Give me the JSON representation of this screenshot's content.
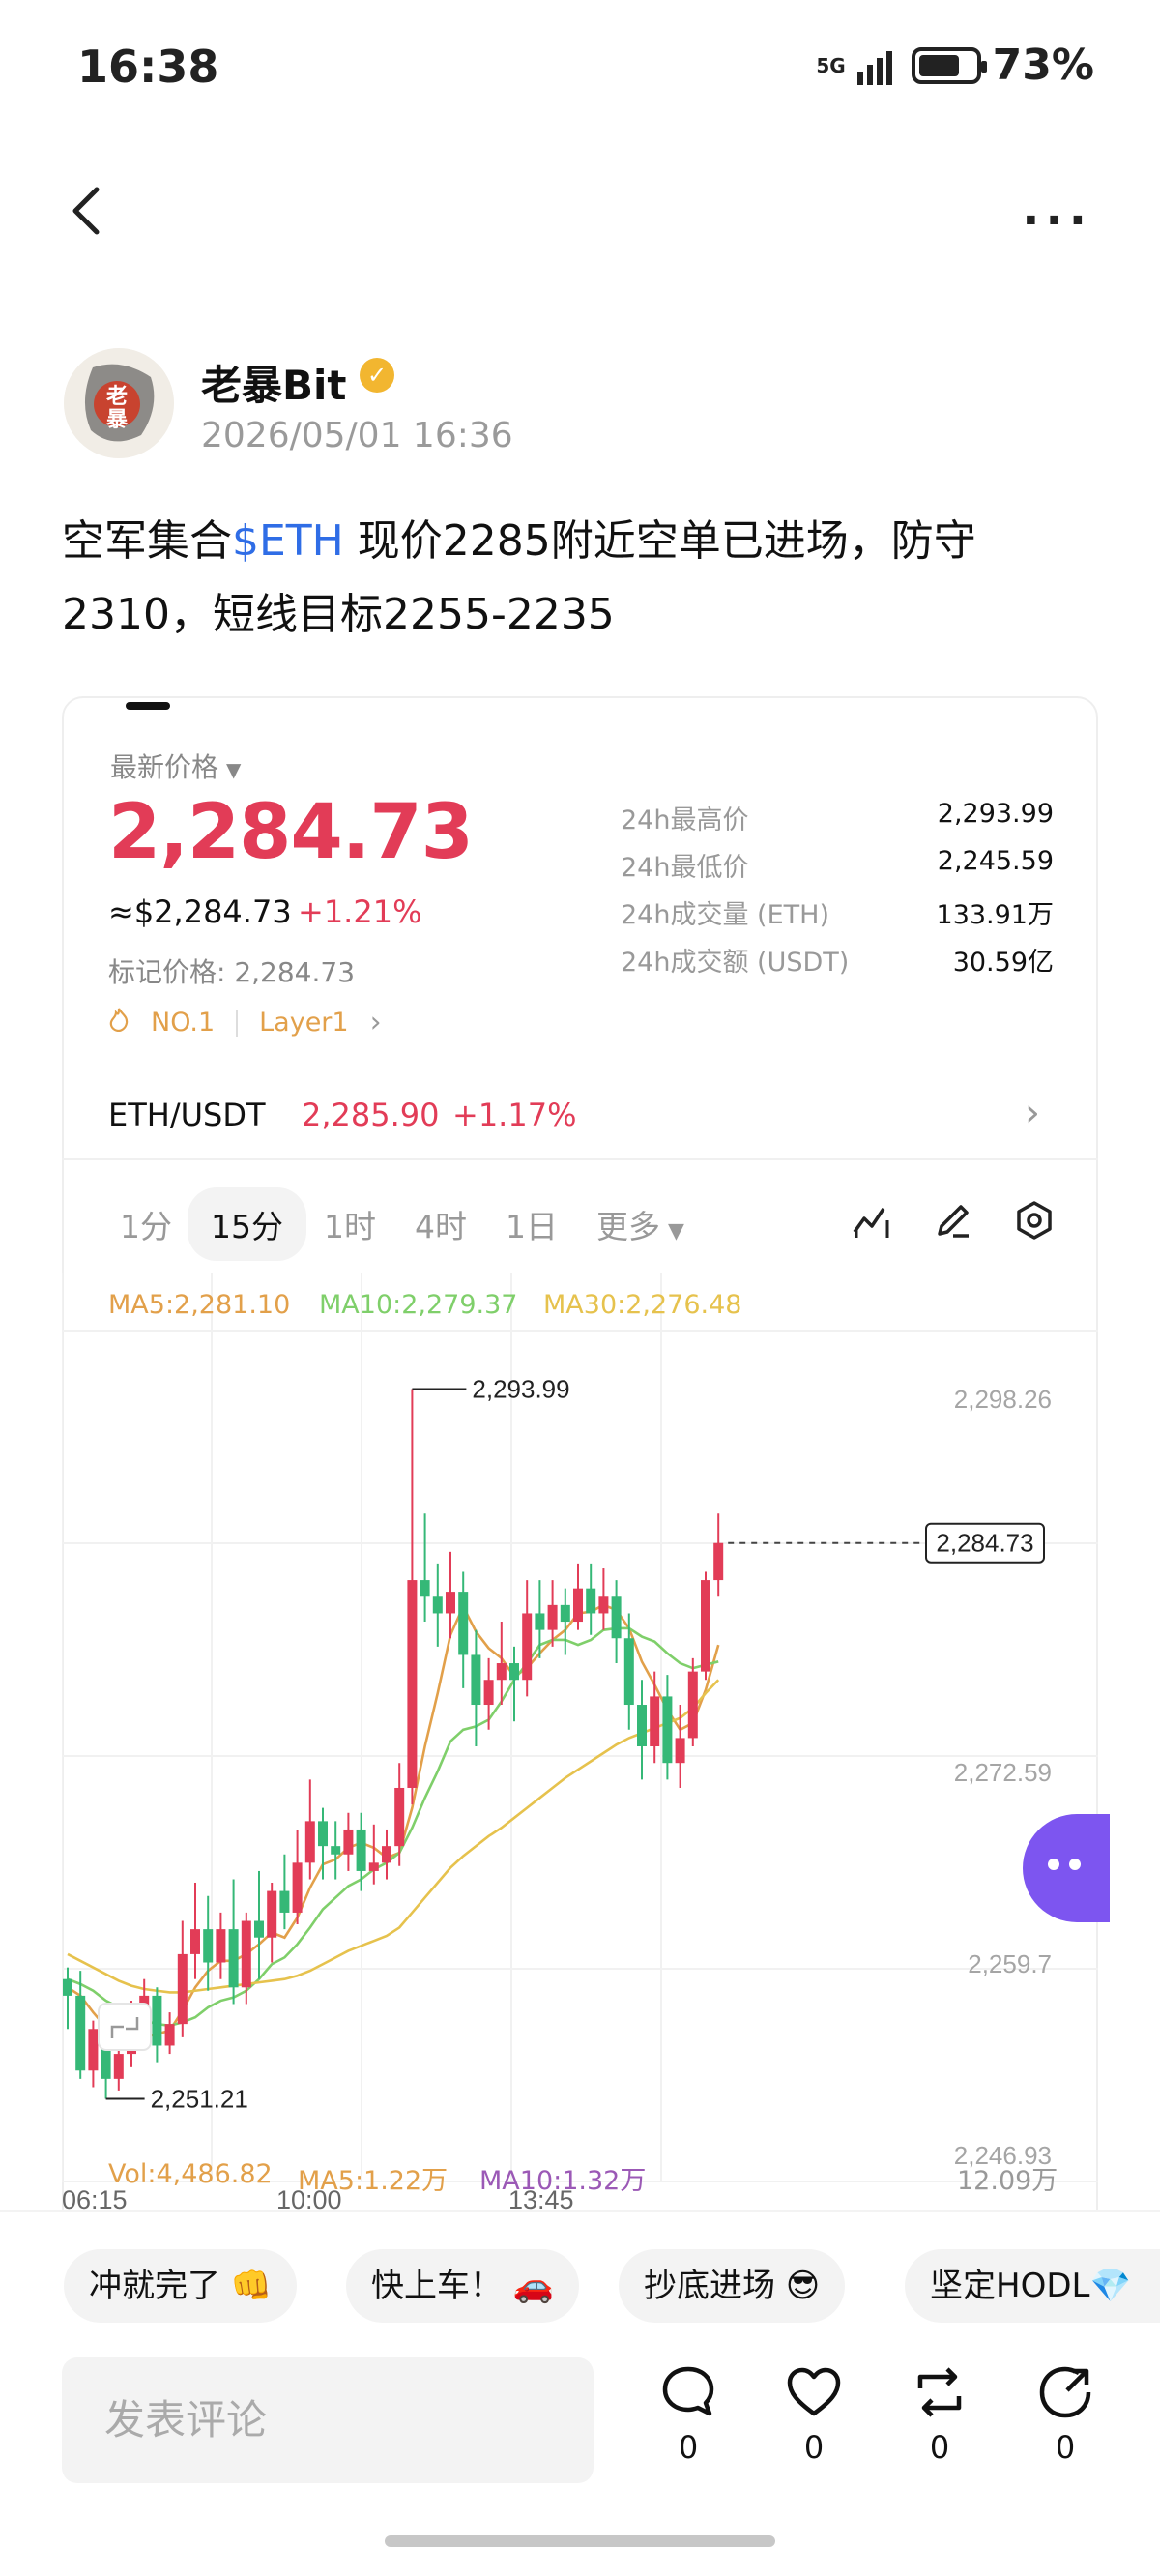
{
  "status_bar": {
    "time": "16:38",
    "network": "5G",
    "battery": "73%",
    "battery_level": 0.73
  },
  "nav": {
    "back_icon": "chevron-left-icon",
    "more_icon": "more-horizontal-icon"
  },
  "author": {
    "name": "老暴Bit",
    "avatar_text_1": "老",
    "avatar_text_2": "暴",
    "verified_icon": "verified-badge-icon",
    "time": "2026/05/01 16:36"
  },
  "post": {
    "text_before": "空军集合",
    "tag": "$ETH",
    "text_after": " 现价2285附近空单已进场，防守2310，短线目标2255-2235"
  },
  "market": {
    "latest_label": "最新价格",
    "price": "2,284.73",
    "usd_price": "≈$2,284.73",
    "change": "+1.21%",
    "mark_price": "标记价格: 2,284.73",
    "tag_rank": "NO.1",
    "tag_sector": "Layer1",
    "stats": [
      {
        "label": "24h最高价",
        "value": "2,293.99"
      },
      {
        "label": "24h最低价",
        "value": "2,245.59"
      },
      {
        "label": "24h成交量 (ETH)",
        "value": "133.91万"
      },
      {
        "label": "24h成交额 (USDT)",
        "value": "30.59亿"
      }
    ],
    "pair": {
      "name": "ETH/USDT",
      "price": "2,285.90",
      "change": "+1.17%"
    }
  },
  "timeframes": {
    "tabs": [
      "1分",
      "15分",
      "1时",
      "4时",
      "1日"
    ],
    "more": "更多",
    "active": "15分"
  },
  "tools": [
    "indicator-icon",
    "draw-pen-icon",
    "settings-hex-icon"
  ],
  "ma_legend": [
    {
      "label": "MA5:2,281.10",
      "color": "#e2a04a"
    },
    {
      "label": "MA10:2,279.37",
      "color": "#7fcf6a"
    },
    {
      "label": "MA30:2,276.48",
      "color": "#e6c24d"
    }
  ],
  "chart_data": {
    "type": "candlestick",
    "interval": "15分",
    "x_ticks": [
      "06:15",
      "10:00",
      "13:45"
    ],
    "y_ticks": [
      "2,298.26",
      "2,272.59",
      "2,259.7",
      "2,246.93"
    ],
    "y_range": [
      2244.0,
      2301.0
    ],
    "high_label": "2,293.99",
    "low_label": "2,251.21",
    "last_price_label": "2,284.73",
    "last_price": 2284.73,
    "candles": [
      [
        2258.5,
        2257.5,
        2259.2,
        2255.5
      ],
      [
        2257.5,
        2253.0,
        2259.0,
        2252.5
      ],
      [
        2253.0,
        2255.5,
        2256.0,
        2252.0
      ],
      [
        2255.5,
        2252.5,
        2256.0,
        2251.3
      ],
      [
        2252.5,
        2254.0,
        2255.0,
        2251.8
      ],
      [
        2254.0,
        2255.5,
        2257.2,
        2253.2
      ],
      [
        2255.5,
        2257.5,
        2258.5,
        2255.0
      ],
      [
        2257.5,
        2254.5,
        2258.0,
        2253.5
      ],
      [
        2254.5,
        2255.8,
        2256.5,
        2254.0
      ],
      [
        2255.8,
        2260.0,
        2262.0,
        2255.0
      ],
      [
        2260.0,
        2261.5,
        2264.3,
        2258.5
      ],
      [
        2261.5,
        2259.5,
        2263.5,
        2257.8
      ],
      [
        2259.5,
        2261.5,
        2262.5,
        2258.5
      ],
      [
        2261.5,
        2258.0,
        2264.5,
        2257.0
      ],
      [
        2258.0,
        2262.0,
        2262.5,
        2257.0
      ],
      [
        2262.0,
        2261.0,
        2265.0,
        2258.5
      ],
      [
        2261.0,
        2263.8,
        2264.3,
        2259.5
      ],
      [
        2263.8,
        2262.5,
        2266.0,
        2261.5
      ],
      [
        2262.5,
        2265.5,
        2267.5,
        2261.8
      ],
      [
        2265.5,
        2268.0,
        2270.5,
        2264.5
      ],
      [
        2268.0,
        2266.5,
        2268.8,
        2264.5
      ],
      [
        2266.5,
        2266.0,
        2268.0,
        2264.5
      ],
      [
        2266.0,
        2267.5,
        2268.5,
        2265.0
      ],
      [
        2267.5,
        2265.0,
        2268.5,
        2263.8
      ],
      [
        2265.0,
        2265.5,
        2267.8,
        2264.2
      ],
      [
        2265.5,
        2266.5,
        2267.5,
        2264.5
      ],
      [
        2266.5,
        2270.0,
        2271.5,
        2265.3
      ],
      [
        2270.0,
        2282.5,
        2293.99,
        2269.0
      ],
      [
        2282.5,
        2281.5,
        2286.5,
        2280.0
      ],
      [
        2281.5,
        2280.5,
        2283.5,
        2278.5
      ],
      [
        2280.5,
        2281.8,
        2284.2,
        2279.0
      ],
      [
        2281.8,
        2278.0,
        2283.0,
        2276.0
      ],
      [
        2278.0,
        2275.0,
        2279.5,
        2272.5
      ],
      [
        2275.0,
        2276.5,
        2277.8,
        2273.5
      ],
      [
        2276.5,
        2277.5,
        2280.0,
        2275.0
      ],
      [
        2277.5,
        2276.5,
        2278.5,
        2274.0
      ],
      [
        2276.5,
        2280.5,
        2282.5,
        2275.5
      ],
      [
        2280.5,
        2279.5,
        2282.5,
        2277.8
      ],
      [
        2279.5,
        2281.0,
        2282.5,
        2278.5
      ],
      [
        2281.0,
        2280.0,
        2282.0,
        2278.0
      ],
      [
        2280.0,
        2282.0,
        2283.5,
        2279.5
      ],
      [
        2282.0,
        2280.5,
        2283.5,
        2279.2
      ],
      [
        2280.5,
        2281.5,
        2283.2,
        2279.5
      ],
      [
        2281.5,
        2279.0,
        2282.5,
        2277.5
      ],
      [
        2279.0,
        2275.0,
        2280.5,
        2273.5
      ],
      [
        2275.0,
        2272.5,
        2276.5,
        2270.5
      ],
      [
        2272.5,
        2275.5,
        2277.0,
        2271.5
      ],
      [
        2275.5,
        2271.5,
        2276.8,
        2270.5
      ],
      [
        2271.5,
        2273.0,
        2275.0,
        2270.0
      ],
      [
        2273.0,
        2277.0,
        2277.8,
        2272.5
      ],
      [
        2277.0,
        2282.5,
        2283.0,
        2276.5
      ],
      [
        2282.5,
        2284.73,
        2286.5,
        2281.5
      ]
    ],
    "ma_lines": {
      "MA5": [
        2258.0,
        2257.5,
        2256.5,
        2255.6,
        2255.2,
        2254.8,
        2255.0,
        2255.2,
        2255.4,
        2256.6,
        2258.0,
        2259.0,
        2259.6,
        2259.6,
        2260.0,
        2260.6,
        2261.3,
        2261.0,
        2262.2,
        2264.0,
        2265.4,
        2265.7,
        2266.4,
        2266.7,
        2266.4,
        2265.8,
        2266.1,
        2268.8,
        2272.5,
        2275.7,
        2279.2,
        2280.9,
        2279.4,
        2278.4,
        2277.8,
        2276.7,
        2277.2,
        2278.1,
        2278.9,
        2279.5,
        2280.5,
        2280.6,
        2281.0,
        2280.7,
        2279.6,
        2277.6,
        2276.2,
        2274.7,
        2273.5,
        2273.9,
        2275.9,
        2278.6
      ],
      "MA10": [
        2258.5,
        2258.2,
        2257.8,
        2257.2,
        2256.8,
        2256.3,
        2256.0,
        2255.8,
        2255.7,
        2255.9,
        2256.2,
        2256.8,
        2257.2,
        2257.4,
        2257.8,
        2258.5,
        2259.4,
        2259.8,
        2260.6,
        2261.6,
        2262.7,
        2263.4,
        2264.1,
        2264.5,
        2265.1,
        2265.5,
        2266.1,
        2267.6,
        2269.4,
        2271.0,
        2272.8,
        2273.5,
        2273.7,
        2274.1,
        2275.2,
        2276.5,
        2277.5,
        2278.6,
        2278.9,
        2278.9,
        2278.6,
        2278.9,
        2279.5,
        2279.6,
        2279.6,
        2279.1,
        2278.8,
        2278.1,
        2277.5,
        2277.2,
        2277.4,
        2277.6
      ],
      "MA30": [
        2260.0,
        2259.6,
        2259.2,
        2258.8,
        2258.4,
        2258.1,
        2257.9,
        2257.8,
        2257.7,
        2257.7,
        2257.8,
        2257.9,
        2258.0,
        2258.1,
        2258.2,
        2258.3,
        2258.4,
        2258.5,
        2258.7,
        2259.0,
        2259.4,
        2259.8,
        2260.2,
        2260.5,
        2260.8,
        2261.1,
        2261.6,
        2262.5,
        2263.4,
        2264.3,
        2265.2,
        2265.9,
        2266.5,
        2267.1,
        2267.6,
        2268.2,
        2268.8,
        2269.4,
        2270.0,
        2270.6,
        2271.1,
        2271.6,
        2272.1,
        2272.6,
        2273.0,
        2273.3,
        2273.6,
        2273.9,
        2274.2,
        2274.8,
        2275.7,
        2276.5
      ]
    }
  },
  "volume": {
    "vol": "Vol:4,486.82",
    "ma5": "MA5:1.22万",
    "ma10": "MA10:1.32万",
    "axis_max": "12.09万"
  },
  "reactions": [
    {
      "label": "冲就完了 👊"
    },
    {
      "label": "快上车！ 🚗"
    },
    {
      "label": "抄底进场 😎"
    },
    {
      "label": "坚定HODL💎"
    }
  ],
  "comment": {
    "placeholder": "发表评论"
  },
  "actions": [
    {
      "icon": "comment-icon",
      "count": "0"
    },
    {
      "icon": "like-heart-icon",
      "count": "0"
    },
    {
      "icon": "repost-icon",
      "count": "0"
    },
    {
      "icon": "share-icon",
      "count": "0"
    }
  ],
  "colors": {
    "up": "#e23c57",
    "down": "#35b877",
    "link": "#2f6de6",
    "price_red": "#e23c57"
  }
}
